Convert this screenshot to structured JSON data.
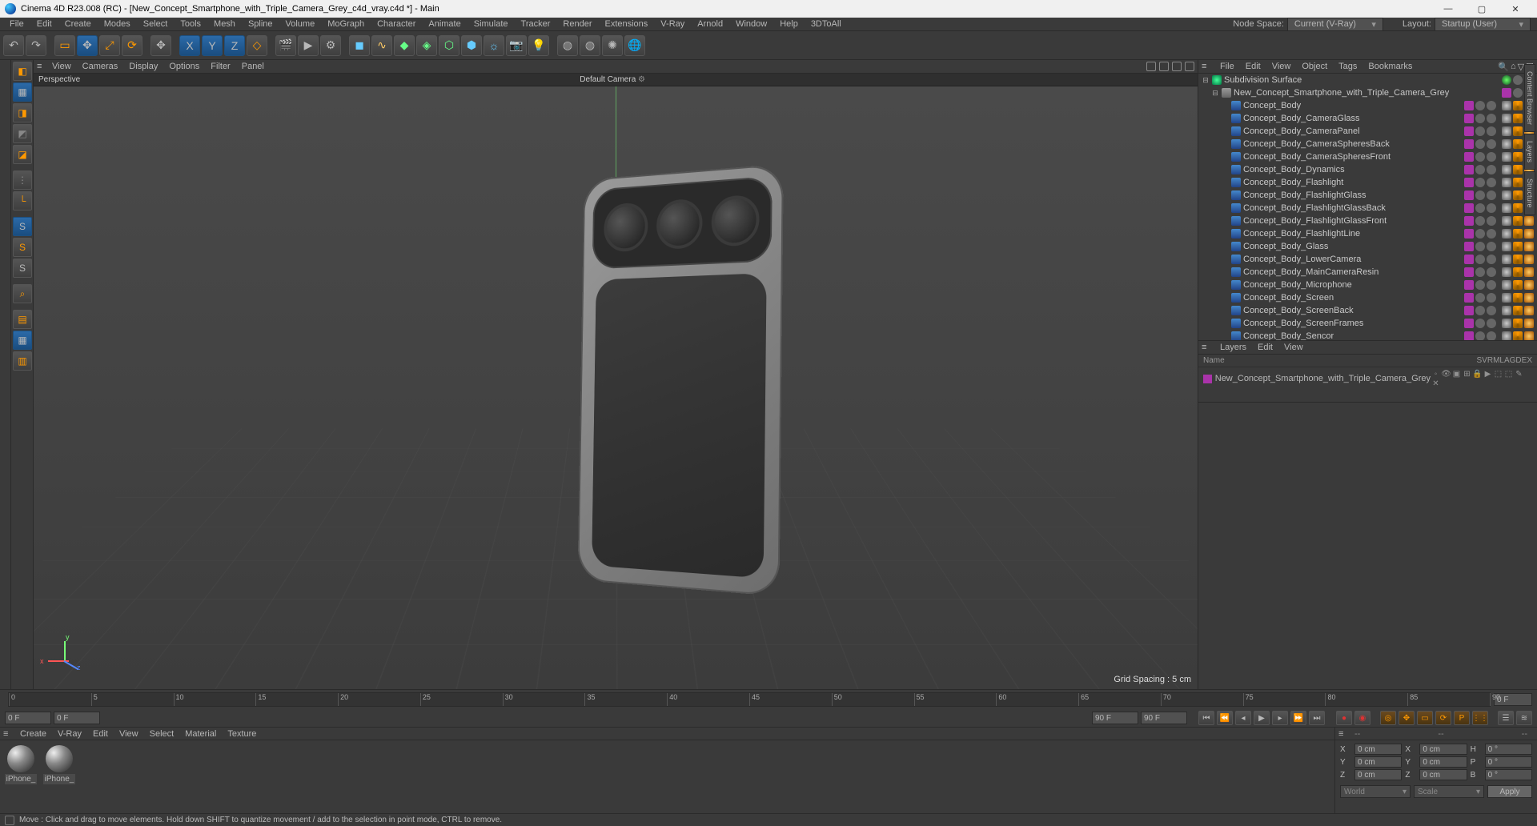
{
  "titlebar": {
    "text": "Cinema 4D R23.008 (RC) - [New_Concept_Smartphone_with_Triple_Camera_Grey_c4d_vray.c4d *] - Main"
  },
  "menubar": {
    "items": [
      "File",
      "Edit",
      "Create",
      "Modes",
      "Select",
      "Tools",
      "Mesh",
      "Spline",
      "Volume",
      "MoGraph",
      "Character",
      "Animate",
      "Simulate",
      "Tracker",
      "Render",
      "Extensions",
      "V-Ray",
      "Arnold",
      "Window",
      "Help",
      "3DToAll"
    ],
    "node_space_label": "Node Space:",
    "node_space_value": "Current (V-Ray)",
    "layout_label": "Layout:",
    "layout_value": "Startup (User)"
  },
  "viewport": {
    "menu": [
      "View",
      "Cameras",
      "Display",
      "Options",
      "Filter",
      "Panel"
    ],
    "label": "Perspective",
    "camera": "Default Camera",
    "grid_label": "Grid Spacing : 5 cm",
    "axes": {
      "x": "x",
      "y": "y",
      "z": "z"
    }
  },
  "object_panel": {
    "menu": [
      "File",
      "Edit",
      "View",
      "Object",
      "Tags",
      "Bookmarks"
    ],
    "root": {
      "name": "Subdivision Surface",
      "icon": "subdiv",
      "expanded": true
    },
    "group": {
      "name": "New_Concept_Smartphone_with_Triple_Camera_Grey",
      "icon": "null",
      "expanded": true
    },
    "items": [
      "Concept_Body",
      "Concept_Body_CameraGlass",
      "Concept_Body_CameraPanel",
      "Concept_Body_CameraSpheresBack",
      "Concept_Body_CameraSpheresFront",
      "Concept_Body_Dynamics",
      "Concept_Body_Flashlight",
      "Concept_Body_FlashlightGlass",
      "Concept_Body_FlashlightGlassBack",
      "Concept_Body_FlashlightGlassFront",
      "Concept_Body_FlashlightLine",
      "Concept_Body_Glass",
      "Concept_Body_LowerCamera",
      "Concept_Body_MainCameraResin",
      "Concept_Body_Microphone",
      "Concept_Body_Screen",
      "Concept_Body_ScreenBack",
      "Concept_Body_ScreenFrames",
      "Concept_Body_Sencor"
    ]
  },
  "layers_panel": {
    "menu": [
      "Layers",
      "Edit",
      "View"
    ],
    "header": {
      "name": "Name",
      "cols": [
        "S",
        "V",
        "R",
        "M",
        "L",
        "A",
        "G",
        "D",
        "E",
        "X"
      ]
    },
    "row": {
      "name": "New_Concept_Smartphone_with_Triple_Camera_Grey"
    }
  },
  "timeline": {
    "start": "0 F",
    "end": "90 F",
    "current": "0 F",
    "range_start": "0 F",
    "range_end": "90 F",
    "ticks": [
      0,
      5,
      10,
      15,
      20,
      25,
      30,
      35,
      40,
      45,
      50,
      55,
      60,
      65,
      70,
      75,
      80,
      85,
      90
    ]
  },
  "materials": {
    "menu": [
      "Create",
      "V-Ray",
      "Edit",
      "View",
      "Select",
      "Material",
      "Texture"
    ],
    "items": [
      {
        "name": "iPhone_"
      },
      {
        "name": "iPhone_"
      }
    ]
  },
  "coords": {
    "rows": [
      {
        "a": "X",
        "av": "0 cm",
        "b": "X",
        "bv": "0 cm",
        "c": "H",
        "cv": "0 °"
      },
      {
        "a": "Y",
        "av": "0 cm",
        "b": "Y",
        "bv": "0 cm",
        "c": "P",
        "cv": "0 °"
      },
      {
        "a": "Z",
        "av": "0 cm",
        "b": "Z",
        "bv": "0 cm",
        "c": "B",
        "cv": "0 °"
      }
    ],
    "mode1": "World",
    "mode2": "Scale",
    "apply": "Apply"
  },
  "statusbar": {
    "text": "Move : Click and drag to move elements. Hold down SHIFT to quantize movement / add to the selection in point mode, CTRL to remove."
  },
  "side_tabs": [
    "Content Browser",
    "Layers",
    "Structure"
  ]
}
